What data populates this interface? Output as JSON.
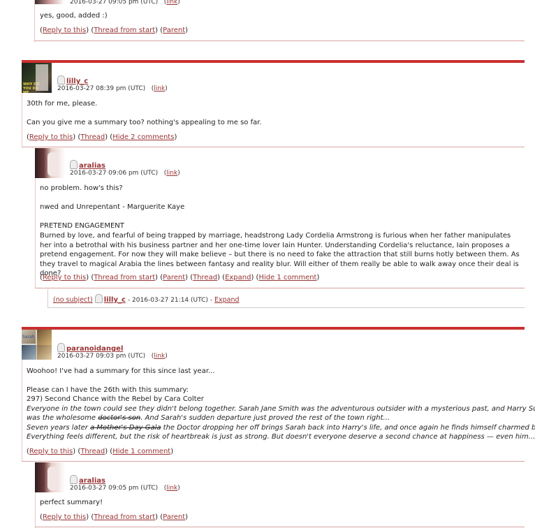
{
  "c0": {
    "date": "2016-03-27 09:05 pm (UTC)",
    "link": "link",
    "body": "yes, good, added :)",
    "actions": [
      "Reply to this",
      "Thread from start",
      "Parent"
    ]
  },
  "c1": {
    "username": "lilly_c",
    "date": "2016-03-27 08:39 pm (UTC)",
    "link": "link",
    "avatar_text": "WHY DO YOU DO ME",
    "line1": "30th for me, please.",
    "line2": "Can you give me a summary too? nothing's appealing to me so far.",
    "actions": [
      "Reply to this",
      "Thread",
      "Hide 2 comments"
    ]
  },
  "c2": {
    "username": "aralias",
    "date": "2016-03-27 09:06 pm (UTC)",
    "link": "link",
    "line1": "no problem. how's this?",
    "line2": "nwed and Unrepentant - Marguerite Kaye",
    "heading": "PRETEND ENGAGEMENT",
    "para": "Burned by love, and fearful of being trapped by marriage, headstrong Lady Cordelia Armstrong is furious when her father manipulates her into a betrothal with his business partner and her one-time lover Iain Hunter. Understanding Cordelia's reluctance, Iain proposes a pretend engagement. For now they will make believe – but there is no need to fake the attraction that still burns hotly between them. As they travel to magical Arabia the lines between fantasy and reality blur. Will either of them really be able to walk away once their deal is done?",
    "actions": [
      "Reply to this",
      "Thread from start",
      "Parent",
      "Thread",
      "Expand",
      "Hide 1 comment"
    ]
  },
  "c3": {
    "subject": "(no subject)",
    "username": "lilly_c",
    "date": "- 2016-03-27 21:14 (UTC) -",
    "expand": "Expand"
  },
  "c4": {
    "username": "paranoidangel",
    "date": "2016-03-27 09:03 pm (UTC)",
    "link": "link",
    "avatar_text": "Sarah",
    "line1": "Woohoo! I've had a summary for this since last year...",
    "line2": "Please can I have the 26th with this summary:",
    "line3": "297) Second Chance with the Rebel by Cara Colter",
    "it1": "Everyone in the town could see they didn't belong together. Sarah Jane Smith was the adventurous outsider with a mysterious past, and Harry Sullivan",
    "it2a": "was the wholesome ",
    "it2s": "doctor's son",
    "it2b": ". And Sarah's sudden departure just proved the rest of the town right...",
    "it3a": "Seven years later ",
    "it3s": "a Mother's Day Gala",
    "it3b": " the Doctor dropping her off brings Sarah back into Harry's life, and once again he finds himself charmed by her.",
    "it4": "Everything feels different, but the risk of heartbreak is just as strong. But doesn't everyone deserve a second chance at happiness — even him...?",
    "actions": [
      "Reply to this",
      "Thread",
      "Hide 1 comment"
    ]
  },
  "c5": {
    "username": "aralias",
    "date": "2016-03-27 09:05 pm (UTC)",
    "link": "link",
    "body": "perfect summary!",
    "actions": [
      "Reply to this",
      "Thread from start",
      "Parent"
    ]
  },
  "colors": {
    "accent": "#c8302e",
    "link": "#993333"
  }
}
